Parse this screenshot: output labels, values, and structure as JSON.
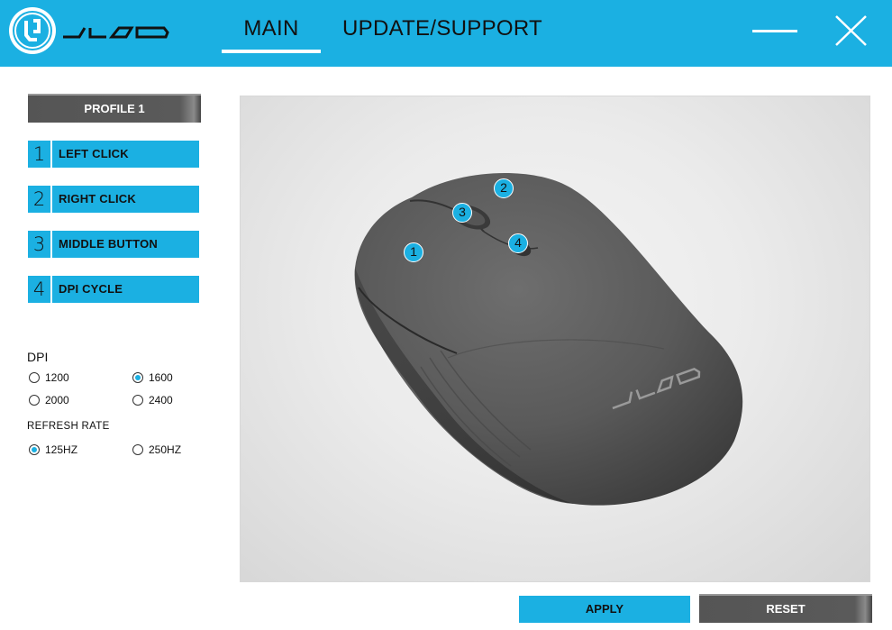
{
  "header": {
    "tabs": [
      {
        "label": "MAIN",
        "active": true
      },
      {
        "label": "UPDATE/SUPPORT",
        "active": false
      }
    ],
    "accent_color": "#1bb0e2"
  },
  "sidebar": {
    "profile_label": "PROFILE 1",
    "buttons": [
      {
        "number": "1",
        "label": "LEFT CLICK"
      },
      {
        "number": "2",
        "label": "RIGHT CLICK"
      },
      {
        "number": "3",
        "label": "MIDDLE BUTTON"
      },
      {
        "number": "4",
        "label": "DPI CYCLE"
      }
    ],
    "dpi": {
      "label": "DPI",
      "options": [
        {
          "label": "1200",
          "selected": false
        },
        {
          "label": "1600",
          "selected": true
        },
        {
          "label": "2000",
          "selected": false
        },
        {
          "label": "2400",
          "selected": false
        }
      ]
    },
    "refresh_rate": {
      "label": "REFRESH RATE",
      "options": [
        {
          "label": "125HZ",
          "selected": true
        },
        {
          "label": "250HZ",
          "selected": false
        }
      ]
    }
  },
  "mouse_markers": [
    "1",
    "2",
    "3",
    "4"
  ],
  "footer": {
    "apply_label": "APPLY",
    "reset_label": "RESET"
  }
}
